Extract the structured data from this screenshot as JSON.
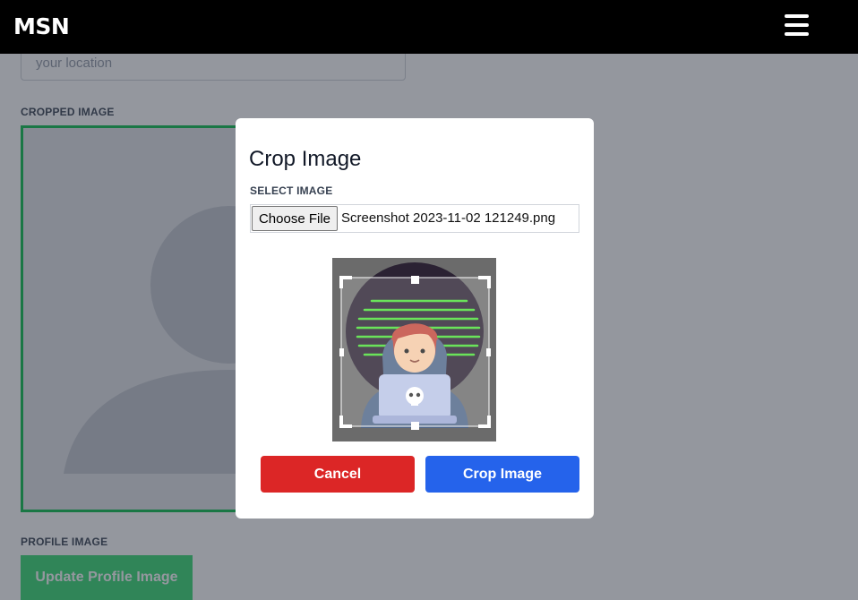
{
  "header": {
    "brand": "MSN"
  },
  "form": {
    "location_placeholder": "your location",
    "cropped_image_label": "CROPPED IMAGE",
    "profile_image_label": "PROFILE IMAGE",
    "update_button": "Update Profile Image"
  },
  "modal": {
    "title": "Crop Image",
    "select_label": "SELECT IMAGE",
    "choose_file": "Choose File",
    "file_name": "Screenshot 2023-11-02 121249.png",
    "cancel": "Cancel",
    "crop": "Crop Image"
  },
  "colors": {
    "cancel": "#dc2626",
    "crop": "#2563eb",
    "update": "#4ade80",
    "crop_border": "#22c55e"
  }
}
